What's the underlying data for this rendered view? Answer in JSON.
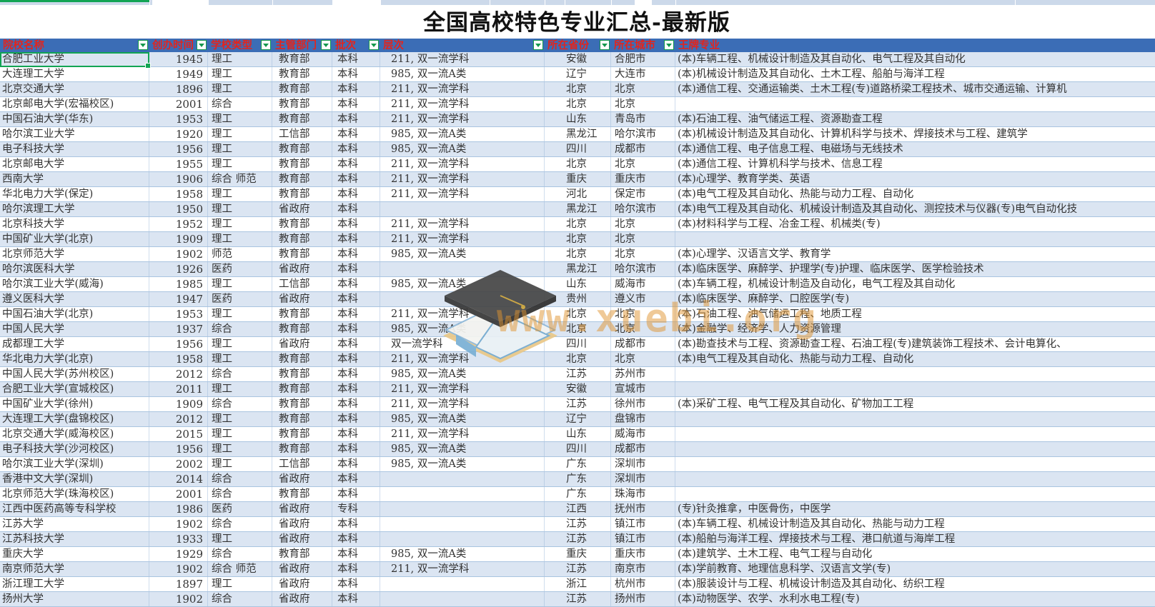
{
  "title": "全国高校特色专业汇总-最新版",
  "watermark": {
    "text": "www.xuebi.org",
    "logo": "graduation-cap-books-logo"
  },
  "colors": {
    "header_bg": "#3b6db6",
    "header_text": "#e3241d",
    "band_row": "#dbe5f2",
    "grid_line": "#a9c4e0",
    "selection_green": "#12a454",
    "watermark_orange": "#e0942f"
  },
  "table": {
    "columns": [
      {
        "key": "name",
        "label": "院校名称",
        "filter": true
      },
      {
        "key": "year",
        "label": "创办时间",
        "filter": true
      },
      {
        "key": "type",
        "label": "学校类型",
        "filter": true
      },
      {
        "key": "dept",
        "label": "主管部门",
        "filter": true
      },
      {
        "key": "batch",
        "label": "批次",
        "filter": true
      },
      {
        "key": "level",
        "label": "层次",
        "filter": true
      },
      {
        "key": "province",
        "label": "所在省份",
        "filter": true
      },
      {
        "key": "city",
        "label": "所在城市",
        "filter": true
      },
      {
        "key": "majors",
        "label": "王牌专业",
        "filter": false
      }
    ],
    "rows": [
      [
        "合肥工业大学",
        "1945",
        "理工",
        "教育部",
        "本科",
        "211, 双一流学科",
        "安徽",
        "合肥市",
        "(本)车辆工程、机械设计制造及其自动化、电气工程及其自动化"
      ],
      [
        "大连理工大学",
        "1949",
        "理工",
        "教育部",
        "本科",
        "985, 双一流A类",
        "辽宁",
        "大连市",
        "(本)机械设计制造及其自动化、土木工程、船舶与海洋工程"
      ],
      [
        "北京交通大学",
        "1896",
        "理工",
        "教育部",
        "本科",
        "211, 双一流学科",
        "北京",
        "北京",
        "(本)通信工程、交通运输类、土木工程(专)道路桥梁工程技术、城市交通运输、计算机"
      ],
      [
        "北京邮电大学(宏福校区)",
        "2001",
        "综合",
        "教育部",
        "本科",
        "211, 双一流学科",
        "北京",
        "北京",
        ""
      ],
      [
        "中国石油大学(华东)",
        "1953",
        "理工",
        "教育部",
        "本科",
        "211, 双一流学科",
        "山东",
        "青岛市",
        "(本)石油工程、油气储运工程、资源勘查工程"
      ],
      [
        "哈尔滨工业大学",
        "1920",
        "理工",
        "工信部",
        "本科",
        "985, 双一流A类",
        "黑龙江",
        "哈尔滨市",
        "(本)机械设计制造及其自动化、计算机科学与技术、焊接技术与工程、建筑学"
      ],
      [
        "电子科技大学",
        "1956",
        "理工",
        "教育部",
        "本科",
        "985, 双一流A类",
        "四川",
        "成都市",
        "(本)通信工程、电子信息工程、电磁场与无线技术"
      ],
      [
        "北京邮电大学",
        "1955",
        "理工",
        "教育部",
        "本科",
        "211, 双一流学科",
        "北京",
        "北京",
        "(本)通信工程、计算机科学与技术、信息工程"
      ],
      [
        "西南大学",
        "1906",
        "综合  师范",
        "教育部",
        "本科",
        "211, 双一流学科",
        "重庆",
        "重庆市",
        "(本)心理学、教育学类、英语"
      ],
      [
        "华北电力大学(保定)",
        "1958",
        "理工",
        "教育部",
        "本科",
        "211, 双一流学科",
        "河北",
        "保定市",
        "(本)电气工程及其自动化、热能与动力工程、自动化"
      ],
      [
        "哈尔滨理工大学",
        "1950",
        "理工",
        "省政府",
        "本科",
        "",
        "黑龙江",
        "哈尔滨市",
        "(本)电气工程及其自动化、机械设计制造及其自动化、测控技术与仪器(专)电气自动化技"
      ],
      [
        "北京科技大学",
        "1952",
        "理工",
        "教育部",
        "本科",
        "211, 双一流学科",
        "北京",
        "北京",
        "(本)材料科学与工程、冶金工程、机械类(专)"
      ],
      [
        "中国矿业大学(北京)",
        "1909",
        "理工",
        "教育部",
        "本科",
        "211, 双一流学科",
        "北京",
        "北京",
        ""
      ],
      [
        "北京师范大学",
        "1902",
        "师范",
        "教育部",
        "本科",
        "985, 双一流A类",
        "北京",
        "北京",
        "(本)心理学、汉语言文学、教育学"
      ],
      [
        "哈尔滨医科大学",
        "1926",
        "医药",
        "省政府",
        "本科",
        "",
        "黑龙江",
        "哈尔滨市",
        "(本)临床医学、麻醉学、护理学(专)护理、临床医学、医学检验技术"
      ],
      [
        "哈尔滨工业大学(威海)",
        "1985",
        "理工",
        "工信部",
        "本科",
        "985, 双一流A类",
        "山东",
        "威海市",
        "(本)车辆工程，机械设计制造及自动化，电气工程及其自动化"
      ],
      [
        "遵义医科大学",
        "1947",
        "医药",
        "省政府",
        "本科",
        "",
        "贵州",
        "遵义市",
        "(本)临床医学、麻醉学、口腔医学(专)"
      ],
      [
        "中国石油大学(北京)",
        "1953",
        "理工",
        "教育部",
        "本科",
        "211, 双一流学科",
        "北京",
        "北京",
        "(本)石油工程、油气储运工程、地质工程"
      ],
      [
        "中国人民大学",
        "1937",
        "综合",
        "教育部",
        "本科",
        "985, 双一流A类",
        "北京",
        "北京",
        "(本)金融学、经济学、人力资源管理"
      ],
      [
        "成都理工大学",
        "1956",
        "理工",
        "省政府",
        "本科",
        "双一流学科",
        "四川",
        "成都市",
        "(本)勘查技术与工程、资源勘查工程、石油工程(专)建筑装饰工程技术、会计电算化、"
      ],
      [
        "华北电力大学(北京)",
        "1958",
        "理工",
        "教育部",
        "本科",
        "211, 双一流学科",
        "北京",
        "北京",
        "(本)电气工程及其自动化、热能与动力工程、自动化"
      ],
      [
        "中国人民大学(苏州校区)",
        "2012",
        "综合",
        "教育部",
        "本科",
        "985, 双一流A类",
        "江苏",
        "苏州市",
        ""
      ],
      [
        "合肥工业大学(宣城校区)",
        "2011",
        "理工",
        "教育部",
        "本科",
        "211, 双一流学科",
        "安徽",
        "宣城市",
        ""
      ],
      [
        "中国矿业大学(徐州)",
        "1909",
        "综合",
        "教育部",
        "本科",
        "211, 双一流学科",
        "江苏",
        "徐州市",
        "(本)采矿工程、电气工程及其自动化、矿物加工工程"
      ],
      [
        "大连理工大学(盘锦校区)",
        "2012",
        "理工",
        "教育部",
        "本科",
        "985, 双一流A类",
        "辽宁",
        "盘锦市",
        ""
      ],
      [
        "北京交通大学(威海校区)",
        "2015",
        "理工",
        "教育部",
        "本科",
        "211, 双一流学科",
        "山东",
        "威海市",
        ""
      ],
      [
        "电子科技大学(沙河校区)",
        "1956",
        "理工",
        "教育部",
        "本科",
        "985, 双一流A类",
        "四川",
        "成都市",
        ""
      ],
      [
        "哈尔滨工业大学(深圳)",
        "2002",
        "理工",
        "工信部",
        "本科",
        "985, 双一流A类",
        "广东",
        "深圳市",
        ""
      ],
      [
        "香港中文大学(深圳)",
        "2014",
        "综合",
        "省政府",
        "本科",
        "",
        "广东",
        "深圳市",
        ""
      ],
      [
        "北京师范大学(珠海校区)",
        "2001",
        "综合",
        "教育部",
        "本科",
        "",
        "广东",
        "珠海市",
        ""
      ],
      [
        "江西中医药高等专科学校",
        "1986",
        "医药",
        "省政府",
        "专科",
        "",
        "江西",
        "抚州市",
        "(专)针灸推拿，中医骨伤，中医学"
      ],
      [
        "江苏大学",
        "1902",
        "综合",
        "省政府",
        "本科",
        "",
        "江苏",
        "镇江市",
        "(本)车辆工程、机械设计制造及其自动化、热能与动力工程"
      ],
      [
        "江苏科技大学",
        "1933",
        "理工",
        "省政府",
        "本科",
        "",
        "江苏",
        "镇江市",
        "(本)船舶与海洋工程、焊接技术与工程、港口航道与海岸工程"
      ],
      [
        "重庆大学",
        "1929",
        "综合",
        "教育部",
        "本科",
        "985, 双一流A类",
        "重庆",
        "重庆市",
        "(本)建筑学、土木工程、电气工程与自动化"
      ],
      [
        "南京师范大学",
        "1902",
        "综合  师范",
        "省政府",
        "本科",
        "211, 双一流学科",
        "江苏",
        "南京市",
        "(本)学前教育、地理信息科学、汉语言文学(专)"
      ],
      [
        "浙江理工大学",
        "1897",
        "理工",
        "省政府",
        "本科",
        "",
        "浙江",
        "杭州市",
        "(本)服装设计与工程、机械设计制造及其自动化、纺织工程"
      ],
      [
        "扬州大学",
        "1902",
        "综合",
        "省政府",
        "本科",
        "",
        "江苏",
        "扬州市",
        "(本)动物医学、农学、水利水电工程(专)"
      ]
    ]
  },
  "selection": {
    "row_index": 0,
    "column_key": "name"
  }
}
